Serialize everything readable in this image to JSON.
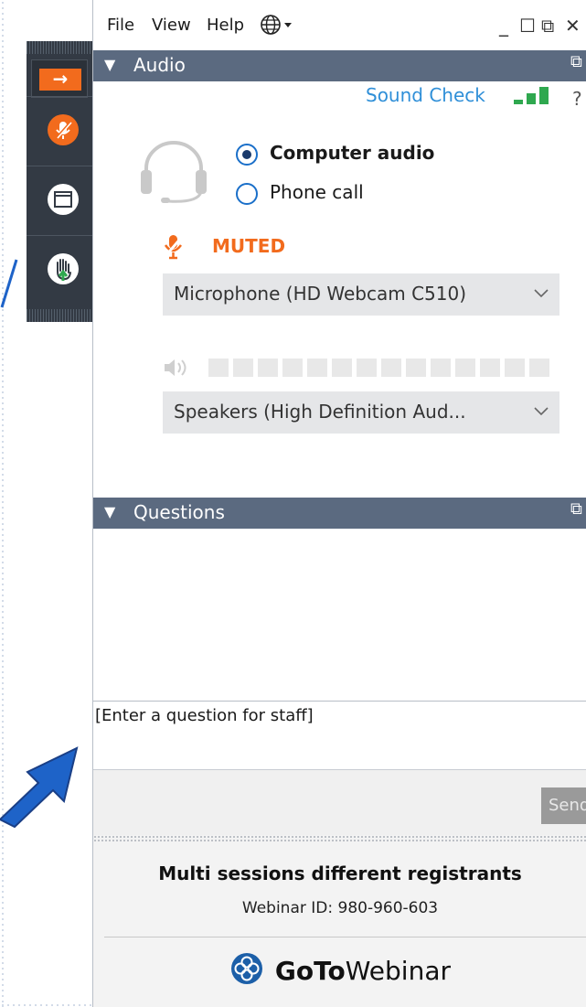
{
  "menubar": {
    "items": [
      "File",
      "View",
      "Help"
    ],
    "window_controls": [
      "_",
      "☐",
      "⧉",
      "✕"
    ]
  },
  "audio": {
    "header": "Audio",
    "sound_check": "Sound Check",
    "options": [
      {
        "label": "Computer audio",
        "selected": true
      },
      {
        "label": "Phone call",
        "selected": false
      }
    ],
    "mute_status": "MUTED",
    "microphone": "Microphone (HD Webcam C510)",
    "speakers": "Speakers (High  Definition  Aud...",
    "level_boxes": 11
  },
  "questions": {
    "header": "Questions",
    "input_placeholder": "[Enter a question for staff]",
    "send_label": "Send"
  },
  "footer": {
    "session_title": "Multi sessions different registrants",
    "webinar_id": "Webinar ID: 980-960-603",
    "logo_bold": "GoTo",
    "logo_light": "Webinar"
  },
  "colors": {
    "accent_orange": "#f26b1d",
    "header_slate": "#5b6a80",
    "link_blue": "#2f8fd8",
    "annotation_blue": "#1e63c8"
  },
  "icons": [
    "arrow-right-icon",
    "mic-muted-icon",
    "window-icon",
    "raise-hand-icon",
    "globe-icon",
    "headset-icon",
    "speaker-icon",
    "signal-bars-icon",
    "help-icon",
    "gotowebinar-flower-icon"
  ]
}
